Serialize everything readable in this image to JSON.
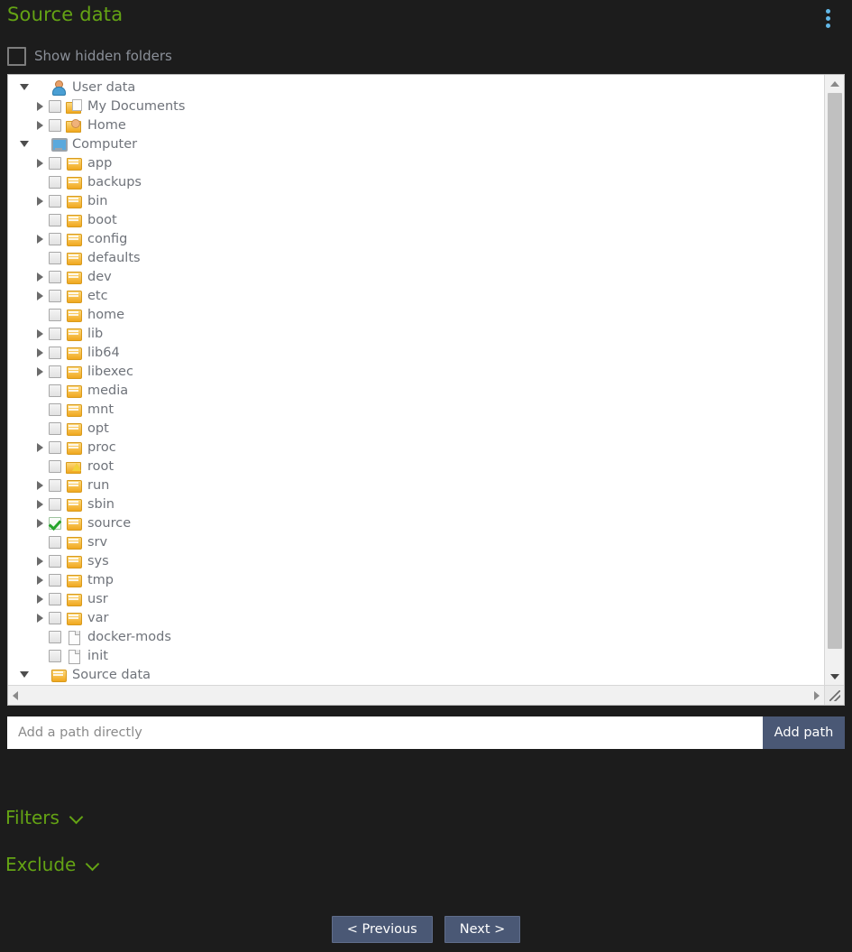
{
  "header": {
    "title": "Source data",
    "menu_icon": "kebab-menu-icon"
  },
  "options": {
    "show_hidden_label": "Show hidden folders",
    "show_hidden_checked": false
  },
  "tree": {
    "nodes": [
      {
        "label": "User data",
        "icon": "user",
        "depth": 0,
        "arrow": "expanded",
        "checkbox": "none",
        "checked": false
      },
      {
        "label": "My Documents",
        "icon": "folder-doc",
        "depth": 1,
        "arrow": "collapsed",
        "checkbox": "unchecked",
        "checked": false
      },
      {
        "label": "Home",
        "icon": "folder-user",
        "depth": 1,
        "arrow": "collapsed",
        "checkbox": "unchecked",
        "checked": false
      },
      {
        "label": "Computer",
        "icon": "computer",
        "depth": 0,
        "arrow": "expanded",
        "checkbox": "none",
        "checked": false
      },
      {
        "label": "app",
        "icon": "folder",
        "depth": 1,
        "arrow": "collapsed",
        "checkbox": "unchecked",
        "checked": false
      },
      {
        "label": "backups",
        "icon": "folder",
        "depth": 1,
        "arrow": "none",
        "checkbox": "unchecked",
        "checked": false
      },
      {
        "label": "bin",
        "icon": "folder",
        "depth": 1,
        "arrow": "collapsed",
        "checkbox": "unchecked",
        "checked": false
      },
      {
        "label": "boot",
        "icon": "folder",
        "depth": 1,
        "arrow": "none",
        "checkbox": "unchecked",
        "checked": false
      },
      {
        "label": "config",
        "icon": "folder",
        "depth": 1,
        "arrow": "collapsed",
        "checkbox": "unchecked",
        "checked": false
      },
      {
        "label": "defaults",
        "icon": "folder",
        "depth": 1,
        "arrow": "none",
        "checkbox": "unchecked",
        "checked": false
      },
      {
        "label": "dev",
        "icon": "folder",
        "depth": 1,
        "arrow": "collapsed",
        "checkbox": "unchecked",
        "checked": false
      },
      {
        "label": "etc",
        "icon": "folder",
        "depth": 1,
        "arrow": "collapsed",
        "checkbox": "unchecked",
        "checked": false
      },
      {
        "label": "home",
        "icon": "folder",
        "depth": 1,
        "arrow": "none",
        "checkbox": "unchecked",
        "checked": false
      },
      {
        "label": "lib",
        "icon": "folder",
        "depth": 1,
        "arrow": "collapsed",
        "checkbox": "unchecked",
        "checked": false
      },
      {
        "label": "lib64",
        "icon": "folder",
        "depth": 1,
        "arrow": "collapsed",
        "checkbox": "unchecked",
        "checked": false
      },
      {
        "label": "libexec",
        "icon": "folder",
        "depth": 1,
        "arrow": "collapsed",
        "checkbox": "unchecked",
        "checked": false
      },
      {
        "label": "media",
        "icon": "folder",
        "depth": 1,
        "arrow": "none",
        "checkbox": "unchecked",
        "checked": false
      },
      {
        "label": "mnt",
        "icon": "folder",
        "depth": 1,
        "arrow": "none",
        "checkbox": "unchecked",
        "checked": false
      },
      {
        "label": "opt",
        "icon": "folder",
        "depth": 1,
        "arrow": "none",
        "checkbox": "unchecked",
        "checked": false
      },
      {
        "label": "proc",
        "icon": "folder",
        "depth": 1,
        "arrow": "collapsed",
        "checkbox": "unchecked",
        "checked": false
      },
      {
        "label": "root",
        "icon": "folder-warn",
        "depth": 1,
        "arrow": "none",
        "checkbox": "unchecked",
        "checked": false
      },
      {
        "label": "run",
        "icon": "folder",
        "depth": 1,
        "arrow": "collapsed",
        "checkbox": "unchecked",
        "checked": false
      },
      {
        "label": "sbin",
        "icon": "folder",
        "depth": 1,
        "arrow": "collapsed",
        "checkbox": "unchecked",
        "checked": false
      },
      {
        "label": "source",
        "icon": "folder",
        "depth": 1,
        "arrow": "collapsed",
        "checkbox": "checked",
        "checked": true
      },
      {
        "label": "srv",
        "icon": "folder",
        "depth": 1,
        "arrow": "none",
        "checkbox": "unchecked",
        "checked": false
      },
      {
        "label": "sys",
        "icon": "folder",
        "depth": 1,
        "arrow": "collapsed",
        "checkbox": "unchecked",
        "checked": false
      },
      {
        "label": "tmp",
        "icon": "folder",
        "depth": 1,
        "arrow": "collapsed",
        "checkbox": "unchecked",
        "checked": false
      },
      {
        "label": "usr",
        "icon": "folder",
        "depth": 1,
        "arrow": "collapsed",
        "checkbox": "unchecked",
        "checked": false
      },
      {
        "label": "var",
        "icon": "folder",
        "depth": 1,
        "arrow": "collapsed",
        "checkbox": "unchecked",
        "checked": false
      },
      {
        "label": "docker-mods",
        "icon": "file",
        "depth": 1,
        "arrow": "none",
        "checkbox": "unchecked",
        "checked": false
      },
      {
        "label": "init",
        "icon": "file",
        "depth": 1,
        "arrow": "none",
        "checkbox": "unchecked",
        "checked": false
      },
      {
        "label": "Source data",
        "icon": "folder",
        "depth": 0,
        "arrow": "expanded",
        "checkbox": "none",
        "checked": false
      }
    ]
  },
  "add_path": {
    "placeholder": "Add a path directly",
    "value": "",
    "button_label": "Add path"
  },
  "sections": [
    {
      "label": "Filters",
      "expanded": false
    },
    {
      "label": "Exclude",
      "expanded": false
    }
  ],
  "footer": {
    "previous_label": "< Previous",
    "next_label": "Next >"
  },
  "colors": {
    "background": "#1c1c1c",
    "accent_green": "#64a314",
    "menu_blue": "#62b8e8",
    "button_blue": "#4a5875",
    "tree_text": "#6f737a",
    "label_gray": "#8b9099"
  }
}
